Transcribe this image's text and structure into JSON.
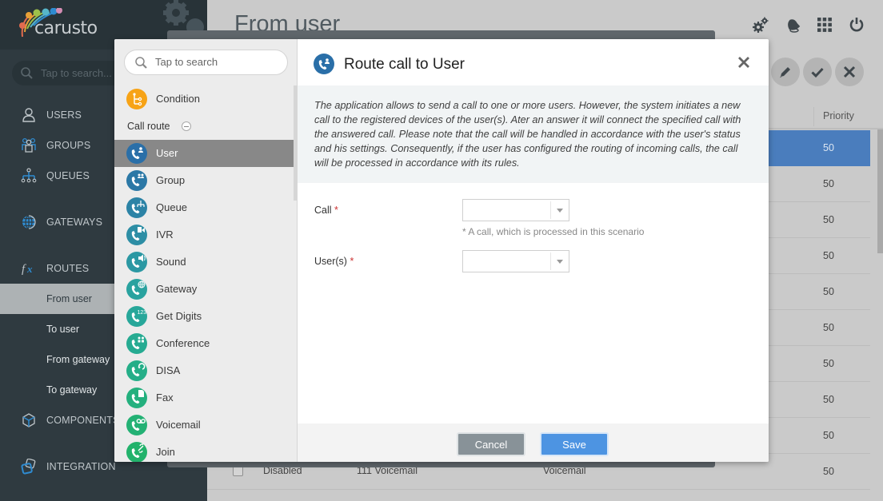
{
  "app": {
    "logo_text": "carusto"
  },
  "nav": {
    "search_placeholder": "Tap to search...",
    "items": [
      {
        "label": "USERS",
        "icon": "user-icon"
      },
      {
        "label": "GROUPS",
        "icon": "groups-icon"
      },
      {
        "label": "QUEUES",
        "icon": "queues-icon"
      },
      {
        "label": "GATEWAYS",
        "icon": "globe-icon"
      },
      {
        "label": "ROUTES",
        "icon": "fx-icon"
      },
      {
        "label": "COMPONENTS",
        "icon": "cube-icon"
      },
      {
        "label": "INTEGRATION",
        "icon": "integration-icon"
      }
    ],
    "route_subitems": [
      {
        "label": "From user",
        "active": true
      },
      {
        "label": "To user",
        "active": false
      },
      {
        "label": "From gateway",
        "active": false
      },
      {
        "label": "To gateway",
        "active": false
      }
    ]
  },
  "page": {
    "title": "From user",
    "top_icons": [
      "settings-icon",
      "bell-icon",
      "apps-grid-icon",
      "power-icon"
    ],
    "actions": [
      "edit-icon",
      "check-icon",
      "close-icon"
    ],
    "table": {
      "priority_header": "Priority",
      "rows": [
        {
          "priority": "50",
          "selected": true
        },
        {
          "priority": "50"
        },
        {
          "priority": "50"
        },
        {
          "priority": "50"
        },
        {
          "priority": "50"
        },
        {
          "priority": "50"
        },
        {
          "priority": "50"
        },
        {
          "priority": "50"
        },
        {
          "priority": "50"
        },
        {
          "priority": "50",
          "status": "Disabled",
          "name": "111 Voicemail",
          "type": "Voicemail"
        }
      ]
    }
  },
  "modal": {
    "palette": {
      "search_placeholder": "Tap to search",
      "condition_label": "Condition",
      "group_label": "Call route",
      "items": [
        {
          "label": "User",
          "active": true,
          "color": "#2a6fa8"
        },
        {
          "label": "Group",
          "color": "#2b78a6"
        },
        {
          "label": "Queue",
          "color": "#2c83a6"
        },
        {
          "label": "IVR",
          "color": "#2d8ea5"
        },
        {
          "label": "Sound",
          "color": "#2b98a3"
        },
        {
          "label": "Gateway",
          "color": "#29a29f"
        },
        {
          "label": "Get Digits",
          "color": "#27a79a"
        },
        {
          "label": "Conference",
          "color": "#26ab92"
        },
        {
          "label": "DISA",
          "color": "#25ae88"
        },
        {
          "label": "Fax",
          "color": "#24b07e"
        },
        {
          "label": "Voicemail",
          "color": "#23b174"
        },
        {
          "label": "Join",
          "color": "#22b26b"
        }
      ]
    },
    "title": "Route call to User",
    "description": "The application allows to send a call to one or more users. However, the system initiates a new call to the registered devices of the user(s). Ater an answer it will connect the specified call with the answered call. Please note that the call will be handled in accordance with the user's status and his settings. Consequently, if the user has configured the routing of incoming calls, the call will be processed in accordance with its rules.",
    "fields": {
      "call_label": "Call",
      "call_value": "",
      "call_hint": "* A call, which is processed in this scenario",
      "users_label": "User(s)",
      "users_value": "",
      "required_mark": "*"
    },
    "buttons": {
      "cancel": "Cancel",
      "save": "Save"
    },
    "colors": {
      "accent": "#4d94e2",
      "header_icon": "#2a6fa8",
      "condition": "#f7a316"
    }
  }
}
